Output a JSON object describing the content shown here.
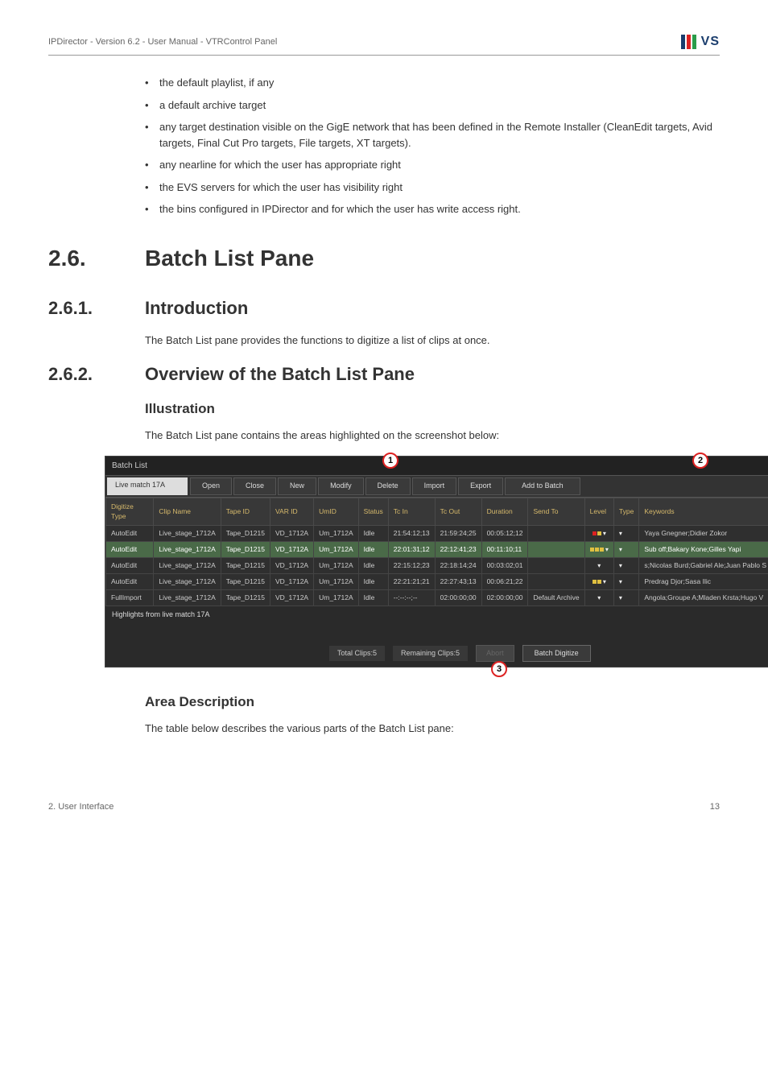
{
  "header": {
    "text": "IPDirector - Version 6.2 - User Manual - VTRControl Panel",
    "logo_text": "VS"
  },
  "bullets": [
    "the default playlist, if any",
    "a default archive target",
    "any target destination visible on the GigE network that has been defined in the Remote Installer (CleanEdit targets, Avid targets, Final Cut Pro targets, File targets, XT targets).",
    "any nearline for which the user has appropriate right",
    "the EVS servers for which the user has visibility right",
    "the bins configured in IPDirector and for which the user has write access right."
  ],
  "sections": {
    "s26_num": "2.6.",
    "s26_title": "Batch List Pane",
    "s261_num": "2.6.1.",
    "s261_title": "Introduction",
    "s261_body": "The Batch List pane provides the functions to digitize a list of clips at once.",
    "s262_num": "2.6.2.",
    "s262_title": "Overview of the Batch List Pane",
    "illustration_head": "Illustration",
    "illustration_body": "The Batch List pane contains the areas highlighted on the screenshot below:",
    "area_head": "Area Description",
    "area_body": "The table below describes the various parts of the Batch List pane:"
  },
  "badges": {
    "b1": "1",
    "b2": "2",
    "b3": "3"
  },
  "batch": {
    "title": "Batch List",
    "match_field": "Live match 17A",
    "buttons": {
      "open": "Open",
      "close": "Close",
      "new": "New",
      "modify": "Modify",
      "delete": "Delete",
      "import": "Import",
      "export": "Export",
      "add": "Add to Batch"
    },
    "columns": [
      "Digitize Type",
      "Clip Name",
      "Tape ID",
      "VAR ID",
      "UmID",
      "Status",
      "Tc In",
      "Tc Out",
      "Duration",
      "Send To",
      "Level",
      "Type",
      "Keywords"
    ],
    "rows": [
      {
        "dt": "AutoEdit",
        "cn": "Live_stage_1712A",
        "tape": "Tape_D1215",
        "var": "VD_1712A",
        "um": "Um_1712A",
        "st": "Idle",
        "tin": "21:54:12;13",
        "tout": "21:59:24;25",
        "dur": "00:05:12;12",
        "send": "",
        "lvl": "ry",
        "type": "",
        "kw": "Yaya Gnegner;Didier Zokor"
      },
      {
        "dt": "AutoEdit",
        "cn": "Live_stage_1712A",
        "tape": "Tape_D1215",
        "var": "VD_1712A",
        "um": "Um_1712A",
        "st": "Idle",
        "tin": "22:01:31;12",
        "tout": "22:12:41;23",
        "dur": "00:11:10;11",
        "send": "",
        "lvl": "yyy",
        "type": "",
        "kw": "Sub off;Bakary Kone;Gilles Yapi",
        "sel": true
      },
      {
        "dt": "AutoEdit",
        "cn": "Live_stage_1712A",
        "tape": "Tape_D1215",
        "var": "VD_1712A",
        "um": "Um_1712A",
        "st": "Idle",
        "tin": "22:15:12;23",
        "tout": "22:18:14;24",
        "dur": "00:03:02;01",
        "send": "",
        "lvl": "",
        "type": "",
        "kw": "s;Nicolas Burd;Gabriel Ale;Juan Pablo S"
      },
      {
        "dt": "AutoEdit",
        "cn": "Live_stage_1712A",
        "tape": "Tape_D1215",
        "var": "VD_1712A",
        "um": "Um_1712A",
        "st": "Idle",
        "tin": "22:21:21;21",
        "tout": "22:27:43;13",
        "dur": "00:06:21;22",
        "send": "",
        "lvl": "yy",
        "type": "",
        "kw": "Predrag Djor;Sasa Ilic"
      },
      {
        "dt": "FullImport",
        "cn": "Live_stage_1712A",
        "tape": "Tape_D1215",
        "var": "VD_1712A",
        "um": "Um_1712A",
        "st": "Idle",
        "tin": "--:--:--;--",
        "tout": "02:00:00;00",
        "dur": "02:00:00;00",
        "send": "Default Archive",
        "lvl": "",
        "type": "",
        "kw": "Angola;Groupe A;Mladen Krsta;Hugo V"
      }
    ],
    "highlights_label": "Highlights from live match 17A",
    "total_clips": "Total Clips:5",
    "remaining_clips": "Remaining Clips:5",
    "abort": "Abort",
    "digitize": "Batch Digitize"
  },
  "footer": {
    "left": "2. User Interface",
    "right": "13"
  }
}
